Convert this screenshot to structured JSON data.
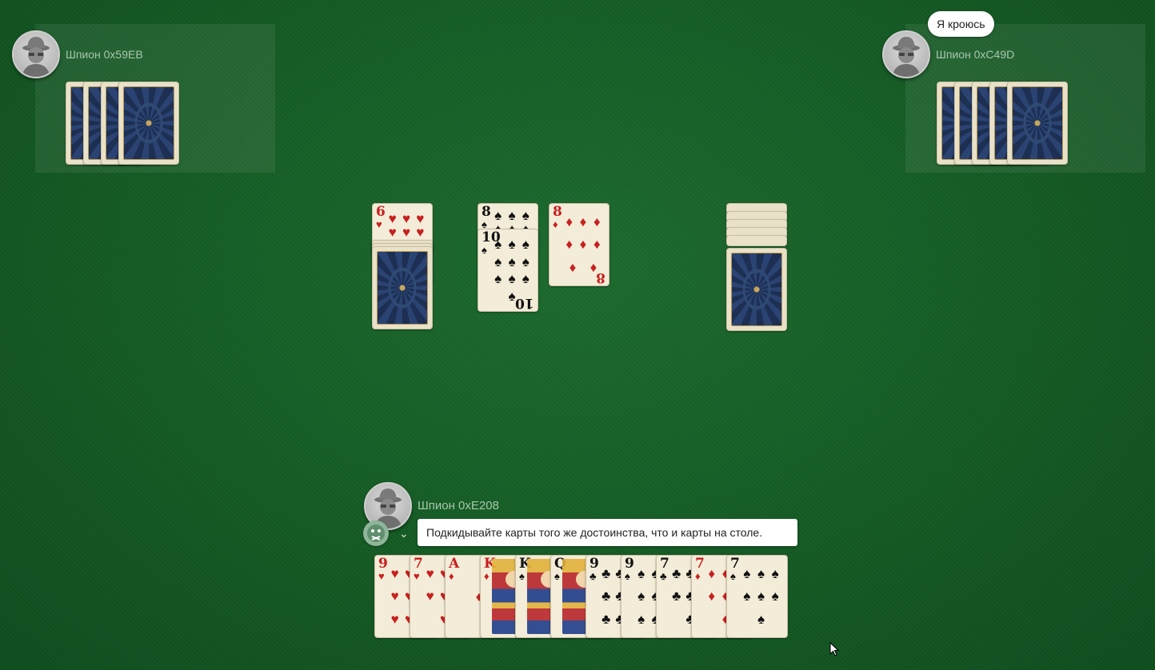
{
  "players": {
    "left": {
      "name": "Шпион 0x59EB"
    },
    "right": {
      "name": "Шпион 0xC49D",
      "speech": "Я кроюсь"
    },
    "me": {
      "name": "Шпион 0xE208"
    }
  },
  "hint_text": "Подкидывайте карты того же достоинства, что и карты на столе.",
  "table": {
    "trump_card": {
      "rank": "6",
      "suit": "♥",
      "color": "red"
    },
    "attack_card": {
      "rank": "8",
      "suit": "♠",
      "color": "black"
    },
    "defense_card": {
      "rank": "10",
      "suit": "♠",
      "color": "black"
    },
    "second_attack_card": {
      "rank": "8",
      "suit": "♦",
      "color": "red"
    }
  },
  "hand": [
    {
      "rank": "9",
      "suit": "♥",
      "color": "red"
    },
    {
      "rank": "7",
      "suit": "♥",
      "color": "red"
    },
    {
      "rank": "A",
      "suit": "♦",
      "color": "red"
    },
    {
      "rank": "K",
      "suit": "♦",
      "color": "red"
    },
    {
      "rank": "K",
      "suit": "♠",
      "color": "black"
    },
    {
      "rank": "Q",
      "suit": "♠",
      "color": "black"
    },
    {
      "rank": "9",
      "suit": "♣",
      "color": "black"
    },
    {
      "rank": "9",
      "suit": "♠",
      "color": "black"
    },
    {
      "rank": "7",
      "suit": "♣",
      "color": "black"
    },
    {
      "rank": "7",
      "suit": "♦",
      "color": "red"
    },
    {
      "rank": "7",
      "suit": "♠",
      "color": "black"
    }
  ],
  "colors": {
    "felt": "#145a24",
    "card_face": "#f3ecd8",
    "card_back": "#1d2f52"
  }
}
